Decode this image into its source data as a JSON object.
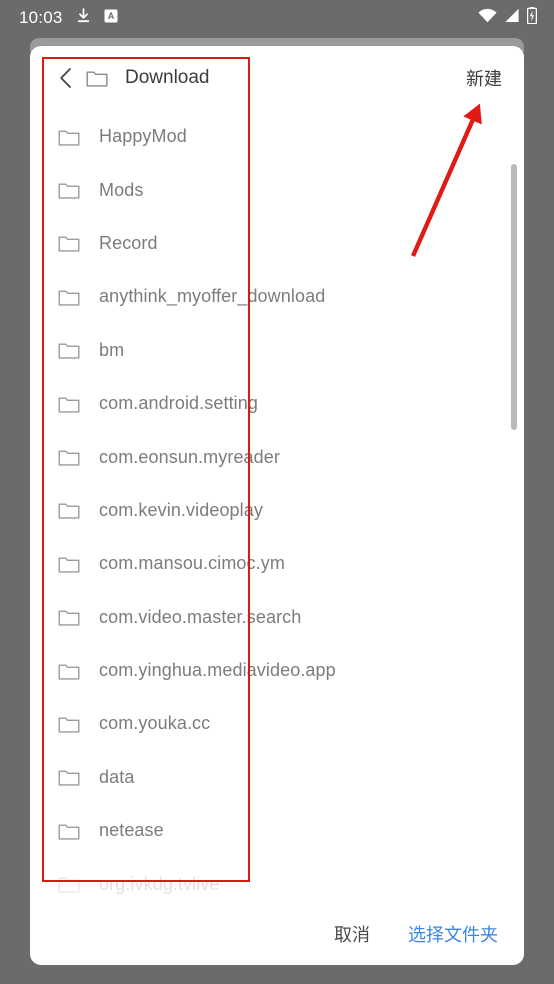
{
  "status_bar": {
    "clock": "10:03",
    "left_icons": [
      {
        "name": "download-icon"
      },
      {
        "name": "app-badge-a-icon",
        "glyph": "A"
      }
    ],
    "right_icons": [
      {
        "name": "wifi-icon"
      },
      {
        "name": "cellular-signal-icon"
      },
      {
        "name": "battery-charging-icon"
      }
    ]
  },
  "background": {
    "partial_sheet_text": ""
  },
  "dialog": {
    "header": {
      "back_icon": "chevron-left-icon",
      "folder_icon": "folder-icon",
      "title": "Download",
      "new_label": "新建"
    },
    "list": {
      "items": [
        {
          "icon": "folder-icon",
          "label": "HappyMod"
        },
        {
          "icon": "folder-icon",
          "label": "Mods"
        },
        {
          "icon": "folder-icon",
          "label": "Record"
        },
        {
          "icon": "folder-icon",
          "label": "anythink_myoffer_download"
        },
        {
          "icon": "folder-icon",
          "label": "bm"
        },
        {
          "icon": "folder-icon",
          "label": "com.android.setting"
        },
        {
          "icon": "folder-icon",
          "label": "com.eonsun.myreader"
        },
        {
          "icon": "folder-icon",
          "label": "com.kevin.videoplay"
        },
        {
          "icon": "folder-icon",
          "label": "com.mansou.cimoc.ym"
        },
        {
          "icon": "folder-icon",
          "label": "com.video.master.search"
        },
        {
          "icon": "folder-icon",
          "label": "com.yinghua.mediavideo.app"
        },
        {
          "icon": "folder-icon",
          "label": "com.youka.cc"
        },
        {
          "icon": "folder-icon",
          "label": "data"
        },
        {
          "icon": "folder-icon",
          "label": "netease"
        },
        {
          "icon": "folder-icon",
          "label": "org.ivkdg.tvlive"
        }
      ],
      "scrollbar": {
        "name": "vertical-scrollbar"
      }
    },
    "footer": {
      "cancel_label": "取消",
      "select_label": "选择文件夹"
    }
  },
  "annotations": {
    "highlight_box": {
      "name": "red-highlight-rectangle",
      "color": "#d81a15"
    },
    "arrow": {
      "name": "red-pointer-arrow",
      "color": "#e01b16",
      "points_to": "新建"
    }
  },
  "colors": {
    "screen_background": "#6b6b6b",
    "dialog_background": "#ffffff",
    "title_text": "#3c3c3c",
    "list_text": "#7c7c7c",
    "accent_blue": "#3b86e0",
    "annotation_red": "#d81a15"
  }
}
